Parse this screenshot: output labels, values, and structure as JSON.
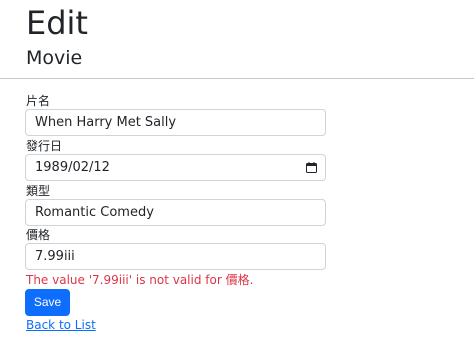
{
  "header": {
    "title": "Edit",
    "subtitle": "Movie"
  },
  "form": {
    "title_label": "片名",
    "title_value": "When Harry Met Sally",
    "release_label": "發行日",
    "release_value": "1989/02/12",
    "genre_label": "類型",
    "genre_value": "Romantic Comedy",
    "price_label": "價格",
    "price_value": "7.99iii",
    "price_error": "The value '7.99iii' is not valid for 價格.",
    "save_label": "Save"
  },
  "nav": {
    "back_link": "Back to List"
  },
  "colors": {
    "primary": "#0d6efd",
    "error": "#dc3545"
  },
  "icons": {
    "date_picker": "calendar-icon"
  }
}
